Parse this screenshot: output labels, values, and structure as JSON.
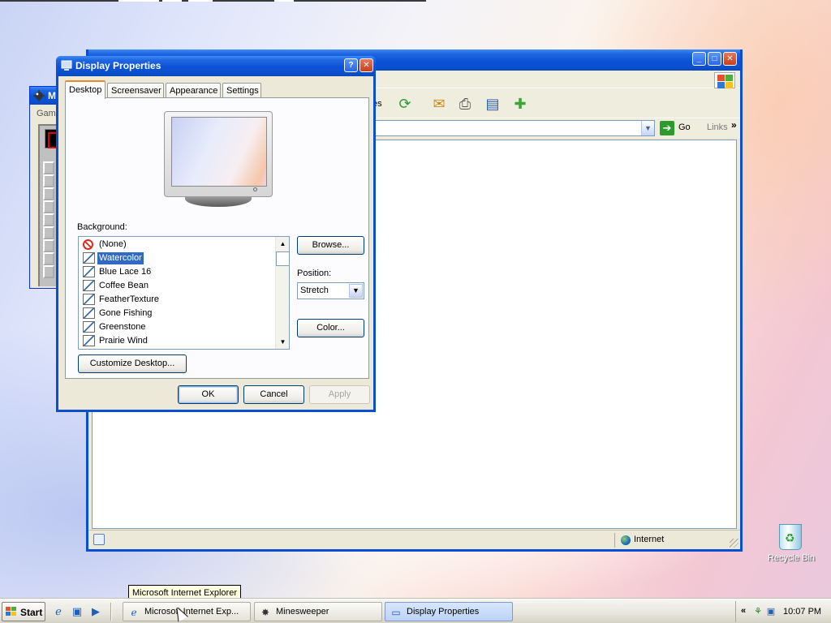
{
  "minesweeper_window": {
    "title_fragment": "M",
    "menu_fragment": "Game"
  },
  "ie_window": {
    "toolbar_fragment": "es",
    "go_label": "Go",
    "links_label": "Links",
    "status_zone": "Internet",
    "toolbar_icons": [
      "history-icon",
      "mail-icon",
      "print-icon",
      "edit-icon",
      "messenger-icon"
    ]
  },
  "dialog": {
    "title": "Display Properties",
    "tabs": [
      {
        "label": "Desktop",
        "active": true
      },
      {
        "label": "Screensaver",
        "active": false
      },
      {
        "label": "Appearance",
        "active": false
      },
      {
        "label": "Settings",
        "active": false
      }
    ],
    "background_label": "Background:",
    "background_items": [
      {
        "label": "(None)",
        "icon": "none-icon",
        "selected": false
      },
      {
        "label": "Watercolor",
        "icon": "wallpaper-icon",
        "selected": true
      },
      {
        "label": "Blue Lace 16",
        "icon": "wallpaper-icon",
        "selected": false
      },
      {
        "label": "Coffee Bean",
        "icon": "wallpaper-icon",
        "selected": false
      },
      {
        "label": "FeatherTexture",
        "icon": "wallpaper-icon",
        "selected": false
      },
      {
        "label": "Gone Fishing",
        "icon": "wallpaper-icon",
        "selected": false
      },
      {
        "label": "Greenstone",
        "icon": "wallpaper-icon",
        "selected": false
      },
      {
        "label": "Prairie Wind",
        "icon": "wallpaper-icon",
        "selected": false
      }
    ],
    "browse_label": "Browse...",
    "position_label": "Position:",
    "position_value": "Stretch",
    "color_label": "Color...",
    "customize_label": "Customize Desktop...",
    "ok_label": "OK",
    "cancel_label": "Cancel",
    "apply_label": "Apply"
  },
  "desktop": {
    "recycle_bin_label": "Recycle Bin"
  },
  "tooltip": {
    "text": "Microsoft Internet Explorer"
  },
  "taskbar": {
    "start_label": "Start",
    "tasks": [
      {
        "label": "Microsoft Internet Exp...",
        "icon": "ie-icon",
        "active": false
      },
      {
        "label": "Minesweeper",
        "icon": "minesweeper-icon",
        "active": false
      },
      {
        "label": "Display Properties",
        "icon": "display-icon",
        "active": true
      }
    ],
    "clock": "10:07 PM"
  },
  "colors": {
    "titlebar_blue": "#0a4fcf",
    "selection_blue": "#316ac5",
    "tab_accent": "#e68b2c",
    "dialog_face": "#ece9d8"
  }
}
